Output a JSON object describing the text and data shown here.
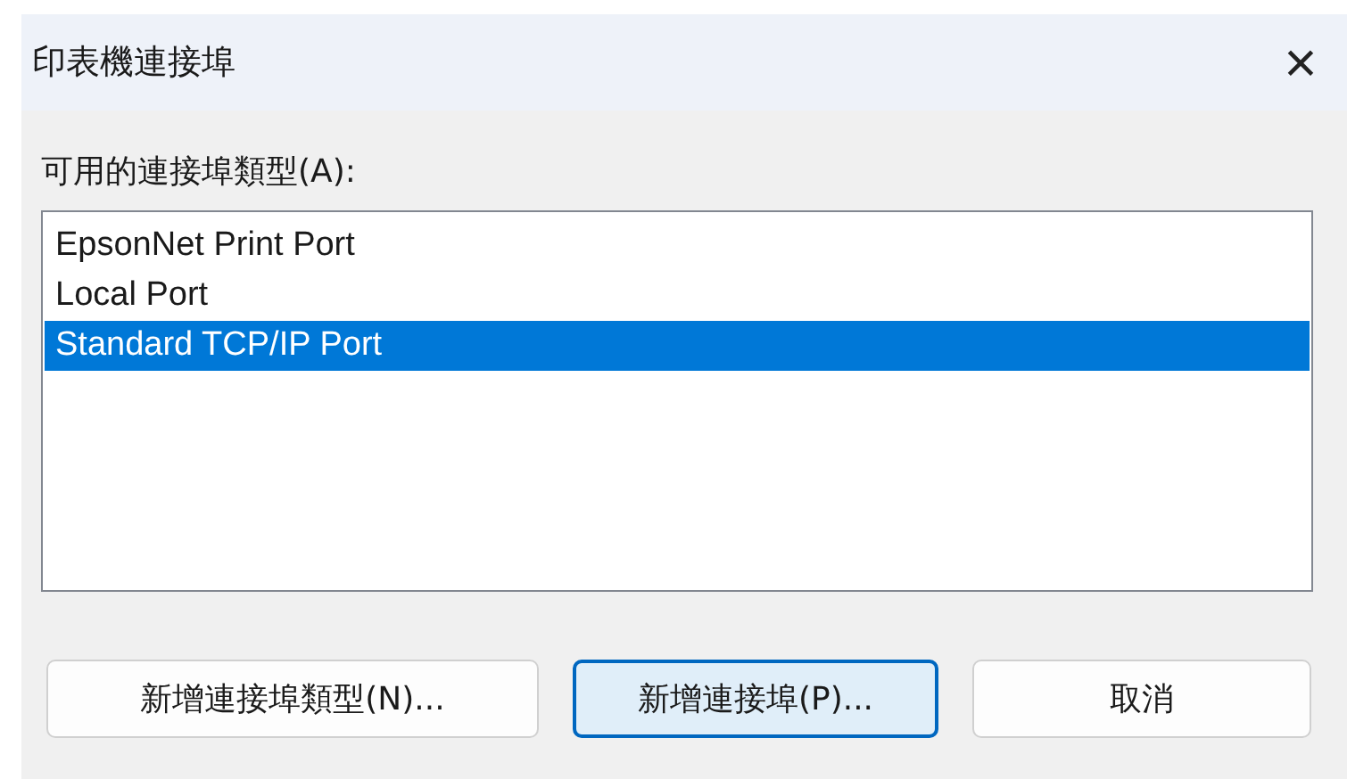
{
  "window": {
    "title": "印表機連接埠",
    "close": "×"
  },
  "list_label": "可用的連接埠類型(A):",
  "port_types": [
    {
      "label": "EpsonNet Print Port",
      "selected": false
    },
    {
      "label": "Local Port",
      "selected": false
    },
    {
      "label": "Standard TCP/IP Port",
      "selected": true
    }
  ],
  "buttons": [
    {
      "label": "新增連接埠類型(N)...",
      "default": false
    },
    {
      "label": "新增連接埠(P)...",
      "default": true
    },
    {
      "label": "取消",
      "default": false
    }
  ]
}
